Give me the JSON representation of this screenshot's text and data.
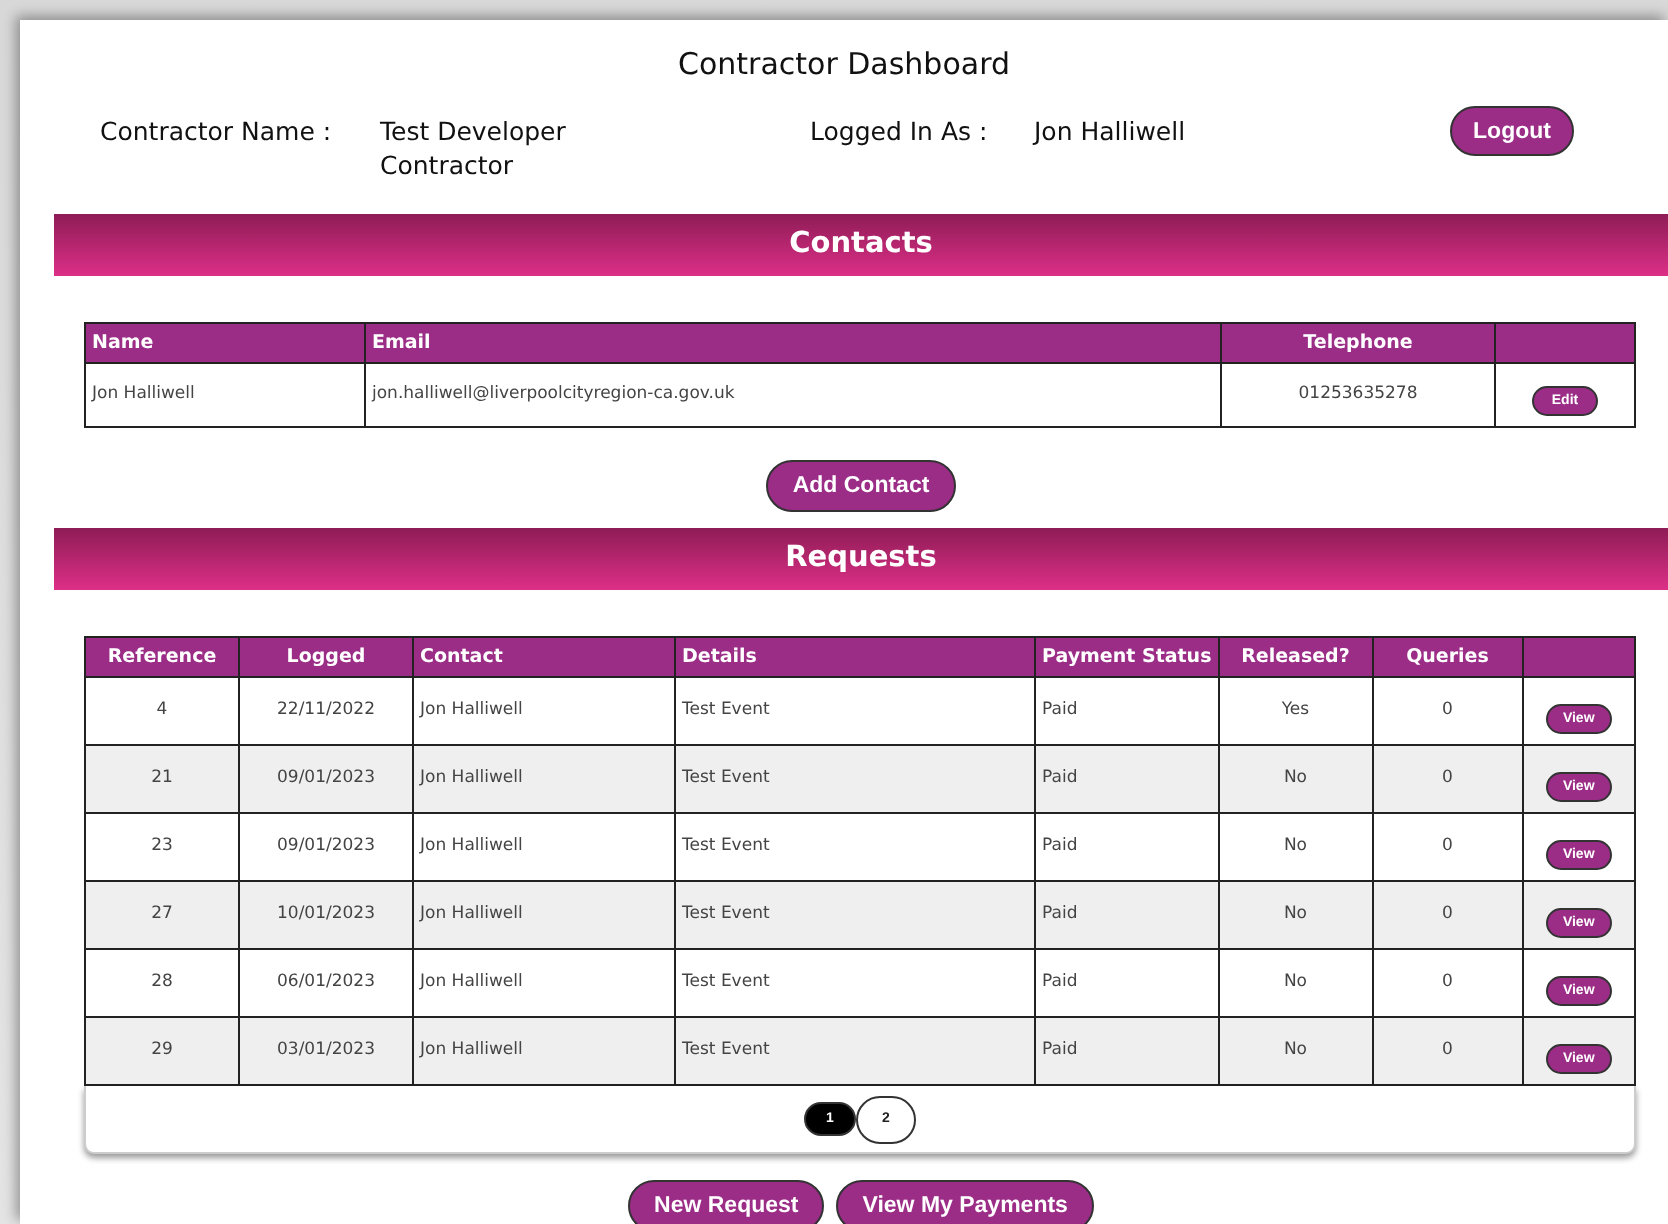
{
  "title": "Contractor Dashboard",
  "header": {
    "contractor_label": "Contractor Name :",
    "contractor_value": "Test Developer Contractor",
    "logged_label": "Logged In As :",
    "logged_value": "Jon Halliwell",
    "logout": "Logout"
  },
  "contacts": {
    "heading": "Contacts",
    "columns": [
      "Name",
      "Email",
      "Telephone"
    ],
    "rows": [
      {
        "name": "Jon Halliwell",
        "email": "jon.halliwell@liverpoolcityregion-ca.gov.uk",
        "telephone": "01253635278",
        "action": "Edit"
      }
    ],
    "add_button": "Add Contact"
  },
  "requests": {
    "heading": "Requests",
    "columns": [
      "Reference",
      "Logged",
      "Contact",
      "Details",
      "Payment Status",
      "Released?",
      "Queries"
    ],
    "rows": [
      {
        "reference": "4",
        "logged": "22/11/2022",
        "contact": "Jon Halliwell",
        "details": "Test Event",
        "payment_status": "Paid",
        "released": "Yes",
        "queries": "0",
        "action": "View"
      },
      {
        "reference": "21",
        "logged": "09/01/2023",
        "contact": "Jon Halliwell",
        "details": "Test Event",
        "payment_status": "Paid",
        "released": "No",
        "queries": "0",
        "action": "View"
      },
      {
        "reference": "23",
        "logged": "09/01/2023",
        "contact": "Jon Halliwell",
        "details": "Test Event",
        "payment_status": "Paid",
        "released": "No",
        "queries": "0",
        "action": "View"
      },
      {
        "reference": "27",
        "logged": "10/01/2023",
        "contact": "Jon Halliwell",
        "details": "Test Event",
        "payment_status": "Paid",
        "released": "No",
        "queries": "0",
        "action": "View"
      },
      {
        "reference": "28",
        "logged": "06/01/2023",
        "contact": "Jon Halliwell",
        "details": "Test Event",
        "payment_status": "Paid",
        "released": "No",
        "queries": "0",
        "action": "View"
      },
      {
        "reference": "29",
        "logged": "03/01/2023",
        "contact": "Jon Halliwell",
        "details": "Test Event",
        "payment_status": "Paid",
        "released": "No",
        "queries": "0",
        "action": "View"
      }
    ],
    "pages": [
      {
        "label": "1",
        "selected": true
      },
      {
        "label": "2",
        "selected": false
      }
    ]
  },
  "buttons": [
    "New Request",
    "View My Payments"
  ]
}
